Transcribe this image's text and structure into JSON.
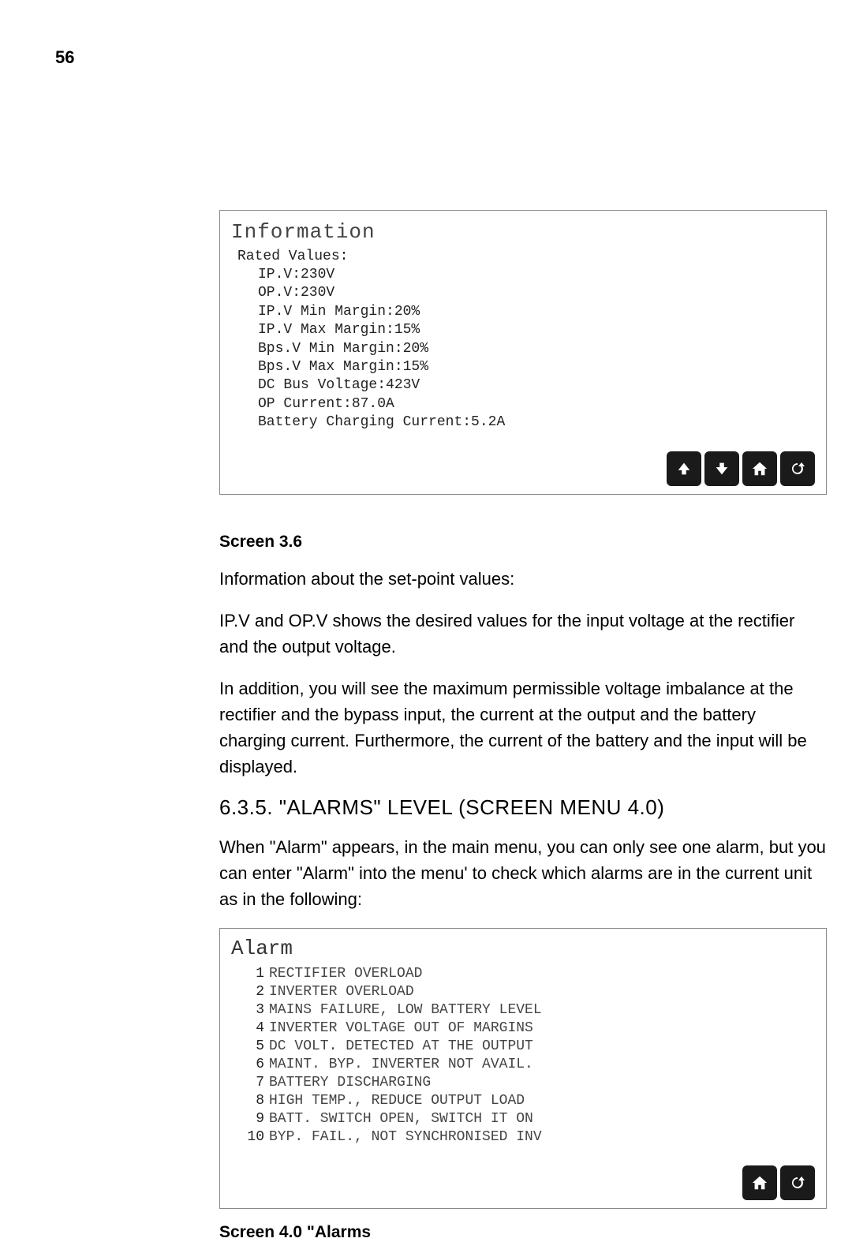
{
  "page_number": "56",
  "info_panel": {
    "title": "Information",
    "subtitle": "Rated Values:",
    "lines": [
      "IP.V:230V",
      "OP.V:230V",
      "IP.V Min Margin:20%",
      "IP.V Max Margin:15%",
      "Bps.V Min Margin:20%",
      "Bps.V Max Margin:15%",
      "DC Bus Voltage:423V",
      "OP Current:87.0A",
      "Battery Charging Current:5.2A"
    ]
  },
  "caption1": "Screen 3.6",
  "para1": "Information about the set-point values:",
  "para2": "IP.V and OP.V shows the desired values for the input voltage at the rectifier and the output voltage.",
  "para3": "In addition, you will see the maximum permissible voltage imbalance at the rectifier and the bypass input, the current at the output and the battery charging current. Furthermore, the current of the battery and the input will be displayed.",
  "section_heading": "6.3.5. \"ALARMS\" LEVEL (SCREEN MENU 4.0)",
  "para4": "When \"Alarm\" appears, in the main menu, you can only see one alarm, but you can enter \"Alarm\" into the menu' to check which alarms are in the current unit as in the following:",
  "alarm_panel": {
    "title": "Alarm",
    "rows": [
      {
        "n": "1",
        "t": "RECTIFIER OVERLOAD"
      },
      {
        "n": "2",
        "t": "INVERTER OVERLOAD"
      },
      {
        "n": "3",
        "t": "MAINS FAILURE, LOW BATTERY LEVEL"
      },
      {
        "n": "4",
        "t": "INVERTER VOLTAGE OUT OF MARGINS"
      },
      {
        "n": "5",
        "t": "DC VOLT. DETECTED AT THE OUTPUT"
      },
      {
        "n": "6",
        "t": "MAINT. BYP. INVERTER NOT AVAIL."
      },
      {
        "n": "7",
        "t": "BATTERY DISCHARGING"
      },
      {
        "n": "8",
        "t": "HIGH TEMP., REDUCE OUTPUT LOAD"
      },
      {
        "n": "9",
        "t": "BATT. SWITCH OPEN, SWITCH IT ON"
      },
      {
        "n": "10",
        "t": "BYP. FAIL., NOT SYNCHRONISED INV"
      }
    ]
  },
  "caption2": "Screen 4.0 \"Alarms"
}
